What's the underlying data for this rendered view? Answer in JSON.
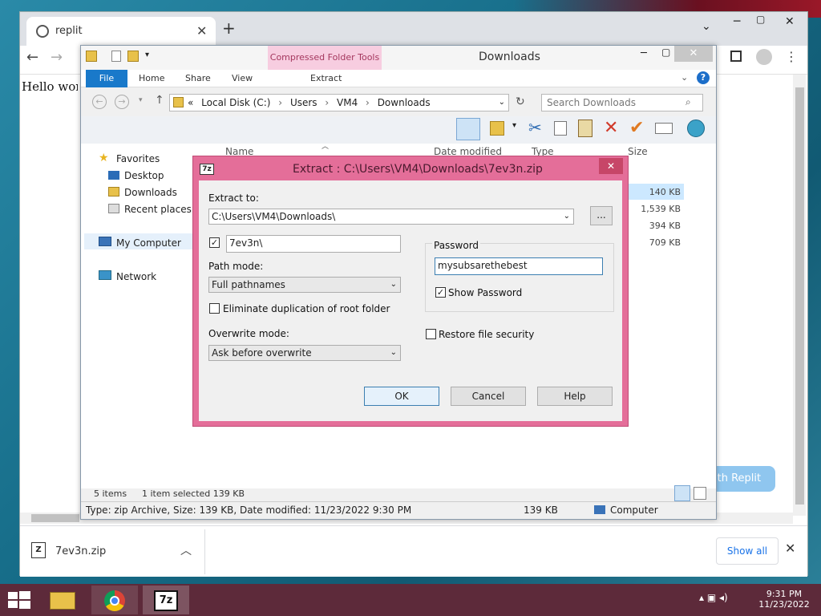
{
  "browser": {
    "tab_title": "replit",
    "page_text": "Hello worl",
    "replit_button": "ith Replit",
    "download_file": "7ev3n.zip",
    "show_all": "Show all"
  },
  "explorer": {
    "title": "Downloads",
    "context_tab": "Compressed Folder Tools",
    "ribbon_tabs": [
      "File",
      "Home",
      "Share",
      "View",
      "Extract"
    ],
    "address": [
      "«",
      "Local Disk (C:)",
      "›",
      "Users",
      "›",
      "VM4",
      "›",
      "Downloads"
    ],
    "search_placeholder": "Search Downloads",
    "nav": {
      "favorites": "Favorites",
      "desktop": "Desktop",
      "downloads": "Downloads",
      "recent": "Recent places",
      "computer": "My Computer",
      "network": "Network"
    },
    "columns": [
      "Name",
      "Date modified",
      "Type",
      "Size"
    ],
    "sizes": [
      "140 KB",
      "1,539 KB",
      "394 KB",
      "709 KB"
    ],
    "status_items": "5 items",
    "status_selected": "1 item selected  139 KB",
    "details": "Type: zip Archive, Size: 139 KB, Date modified: 11/23/2022 9:30 PM",
    "details_size": "139 KB",
    "details_location": "Computer"
  },
  "dialog": {
    "title": "Extract : C:\\Users\\VM4\\Downloads\\7ev3n.zip",
    "extract_to_label": "Extract to:",
    "extract_to_value": "C:\\Users\\VM4\\Downloads\\",
    "browse_label": "...",
    "subfolder_value": "7ev3n\\",
    "path_mode_label": "Path mode:",
    "path_mode_value": "Full pathnames",
    "eliminate_label": "Eliminate duplication of root folder",
    "overwrite_label": "Overwrite mode:",
    "overwrite_value": "Ask before overwrite",
    "password_group": "Password",
    "password_value": "mysubsarethebest",
    "show_password": "Show Password",
    "restore_security": "Restore file security",
    "ok": "OK",
    "cancel": "Cancel",
    "help": "Help"
  },
  "taskbar": {
    "time": "9:31 PM",
    "date": "11/23/2022"
  }
}
